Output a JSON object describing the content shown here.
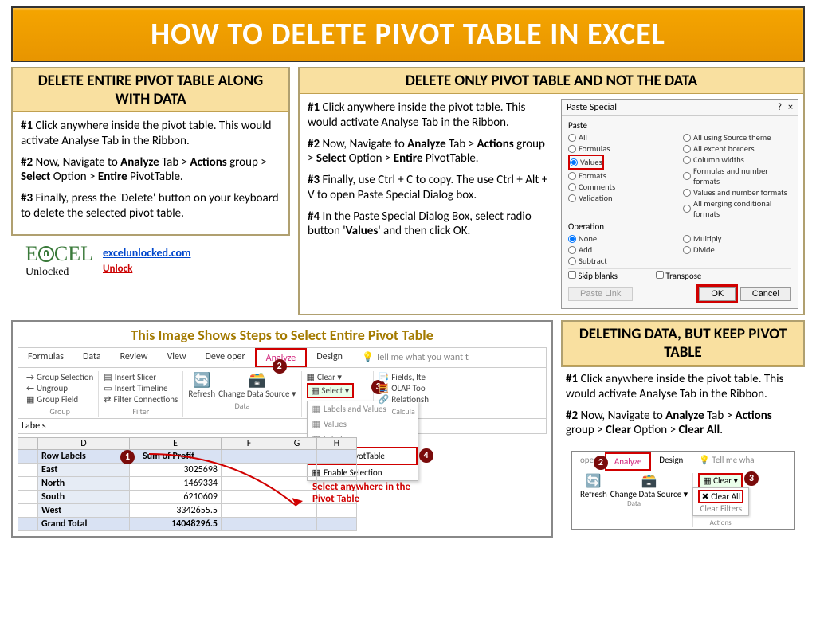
{
  "title": "HOW TO DELETE PIVOT TABLE IN EXCEL",
  "sec1": {
    "heading": "DELETE ENTIRE PIVOT TABLE ALONG WITH DATA",
    "p1a": "#1",
    "p1b": " Click anywhere inside the pivot table. This would activate Analyse Tab in the Ribbon.",
    "p2a": "#2",
    "p2b_1": " Now, Navigate to ",
    "p2b_2": "Analyze",
    "p2b_3": " Tab > ",
    "p2b_4": "Actions",
    "p2b_5": " group > ",
    "p2b_6": "Select",
    "p2b_7": " Option > ",
    "p2b_8": "Entire",
    "p2b_9": " PivotTable.",
    "p3a": "#3",
    "p3b": " Finally, press the 'Delete' button on your keyboard to delete the selected pivot table."
  },
  "sec2": {
    "heading": "DELETE ONLY PIVOT TABLE AND NOT THE DATA",
    "p1a": "#1",
    "p1b": " Click anywhere inside the pivot table. This would activate Analyse Tab in the Ribbon.",
    "p2a": "#2",
    "p2b_1": " Now, Navigate to ",
    "p2b_2": "Analyze",
    "p2b_3": " Tab > ",
    "p2b_4": "Actions",
    "p2b_5": " group > ",
    "p2b_6": "Select",
    "p2b_7": " Option > ",
    "p2b_8": "Entire",
    "p2b_9": " PivotTable.",
    "p3a": "#3",
    "p3b": " Finally, use Ctrl + C to copy. The use Ctrl + Alt + V to open Paste Special Dialog box.",
    "p4a": "#4",
    "p4b_1": " In the Paste Special Dialog Box, select radio button '",
    "p4b_2": "Values",
    "p4b_3": "' and then click OK."
  },
  "sec3": {
    "heading": "DELETING DATA, BUT KEEP PIVOT TABLE",
    "p1a": "#1",
    "p1b": " Click anywhere inside the pivot table. This would activate Analyse Tab in the Ribbon.",
    "p2a": "#2",
    "p2b_1": " Now, Navigate to ",
    "p2b_2": "Analyze",
    "p2b_3": " Tab > ",
    "p2b_4": "Actions",
    "p2b_5": " group > ",
    "p2b_6": "Clear",
    "p2b_7": " Option > ",
    "p2b_8": "Clear All",
    "p2b_9": "."
  },
  "logo": {
    "brand1": "E",
    "brand2": "CEL",
    "brand3": "Unlocked",
    "link": "excelunlocked.com",
    "sub": "Unlock"
  },
  "caption": "This Image Shows Steps to Select Entire Pivot Table",
  "ribbon": {
    "tabs": [
      "Formulas",
      "Data",
      "Review",
      "View",
      "Developer",
      "Analyze",
      "Design"
    ],
    "tell": "Tell me what you want t",
    "group_items": [
      "Group Selection",
      "Ungroup",
      "Group Field"
    ],
    "group_label": "Group",
    "filter_items": [
      "Insert Slicer",
      "Insert Timeline",
      "Filter Connections"
    ],
    "filter_label": "Filter",
    "data_items": [
      "Refresh",
      "Change Data Source ▾"
    ],
    "data_label": "Data",
    "actions": {
      "clear": "Clear ▾",
      "select": "Select ▾"
    },
    "dd": [
      "Labels and Values",
      "Values",
      "Labels",
      "Entire PivotTable",
      "Enable Selection"
    ],
    "right_items": [
      "Fields, Ite",
      "OLAP Too",
      "Relationsh"
    ],
    "calc_label": "Calcula"
  },
  "sheet": {
    "namebox": "Labels",
    "cols": [
      "D",
      "E",
      "F",
      "G",
      "H"
    ],
    "header": [
      "Row Labels",
      "Sum of Profit"
    ],
    "rows": [
      [
        "East",
        "3025698"
      ],
      [
        "North",
        "1469334"
      ],
      [
        "South",
        "6210609"
      ],
      [
        "West",
        "3342655.5"
      ]
    ],
    "gt": [
      "Grand Total",
      "14048296.5"
    ],
    "callout": "Select anywhere in the Pivot Table"
  },
  "dialog": {
    "title": "Paste Special",
    "help": "?",
    "close": "×",
    "grp1": "Paste",
    "left": [
      "All",
      "Formulas",
      "Values",
      "Formats",
      "Comments",
      "Validation"
    ],
    "right": [
      "All using Source theme",
      "All except borders",
      "Column widths",
      "Formulas and number formats",
      "Values and number formats",
      "All merging conditional formats"
    ],
    "grp2": "Operation",
    "op_left": [
      "None",
      "Add",
      "Subtract"
    ],
    "op_right": [
      "Multiply",
      "Divide"
    ],
    "skip": "Skip blanks",
    "trans": "Transpose",
    "pastelink": "Paste Link",
    "ok": "OK",
    "cancel": "Cancel"
  },
  "mini": {
    "tabs": [
      "oper",
      "Analyze",
      "Design"
    ],
    "tell": "Tell me wha",
    "refresh": "Refresh",
    "change": "Change Data Source ▾",
    "data_label": "Data",
    "clear": "Clear ▾",
    "actions_label": "Actions",
    "clearall": "Clear All",
    "clearfilters": "Clear Filters"
  },
  "badges": {
    "b1": "1",
    "b2": "2",
    "b3": "3",
    "b4": "4"
  }
}
